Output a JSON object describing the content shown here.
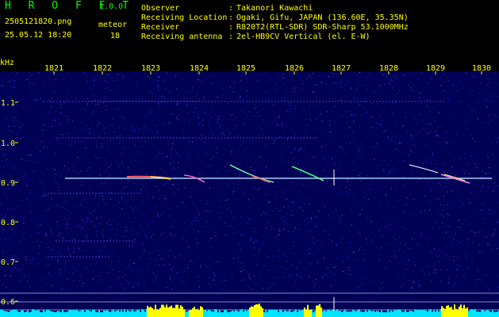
{
  "header": {
    "app_name": "H R O F F T",
    "version": "1.0.0",
    "file_name": "2505121820.png",
    "datetime": "25.05.12 18:20",
    "meteor_label": "meteor",
    "meteor_count": "18",
    "info": [
      {
        "label": "Observer",
        "value": "Takanori Kawachi"
      },
      {
        "label": "Receiving Location",
        "value": "Ogaki, Gifu, JAPAN (136.60E, 35.35N)"
      },
      {
        "label": "Receiver",
        "value": "R820T2(RTL-SDR) SDR-Sharp 53.1000MHz"
      },
      {
        "label": "Receiving antenna",
        "value": "2el-HB9CV Vertical (el. E-W)"
      }
    ],
    "separator": ":"
  },
  "axes": {
    "y_unit": "kHz",
    "x_ticks": [
      "1821",
      "1822",
      "1823",
      "1824",
      "1825",
      "1826",
      "1827",
      "1828",
      "1829",
      "1830"
    ],
    "y_ticks": [
      "1.1",
      "1.0",
      "0.9",
      "0.8",
      "0.7",
      "0.6"
    ]
  },
  "colors": {
    "header_text": "#00ff00",
    "axis_text": "#ffff00",
    "background": "#000066",
    "carrier": "#aaccff",
    "level_fill": "#00e5ff",
    "level_peak": "#ffff00"
  }
}
